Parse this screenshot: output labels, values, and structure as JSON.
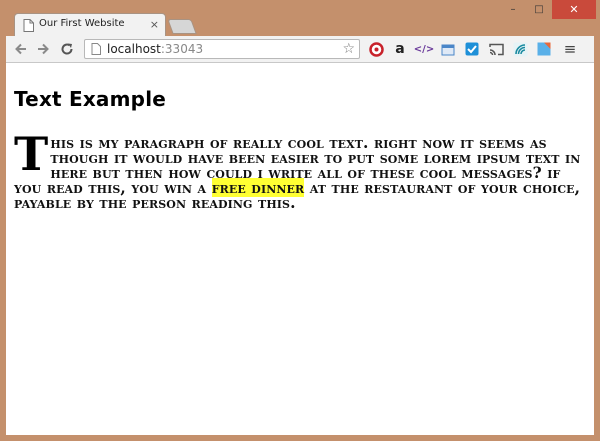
{
  "browser": {
    "tab_title": "Our First Website",
    "tab_close": "×",
    "url_host": "localhost",
    "url_port": ":33043",
    "window_controls": {
      "minimize": "–",
      "maximize": "□",
      "close": "✕"
    },
    "extensions": [
      "lastpass-icon",
      "amazon-icon",
      "code-icon",
      "screenshot-icon",
      "checkbox-icon",
      "cast-icon",
      "wifi-icon",
      "paint-icon"
    ],
    "menu_glyph": "≡"
  },
  "page": {
    "heading": "Text Example",
    "paragraph": {
      "dropcap": "T",
      "text_before": "HIS IS MY PARAGRAPH OF REALLY COOL TEXT. RIGHT NOW IT SEEMS AS THOUGH IT WOULD HAVE BEEN EASIER TO PUT SOME LOREM IPSUM TEXT IN HERE BUT THEN HOW COULD I WRITE ALL OF THESE COOL MESSAGES? IF YOU READ THIS, YOU WIN A ",
      "highlight": "FREE DINNER",
      "text_after": " AT THE RESTAURANT OF YOUR CHOICE, PAYABLE BY THE PERSON READING THIS."
    }
  },
  "colors": {
    "frame": "#c4906c",
    "highlight": "#ffff33",
    "close_button": "#c94a3b"
  }
}
